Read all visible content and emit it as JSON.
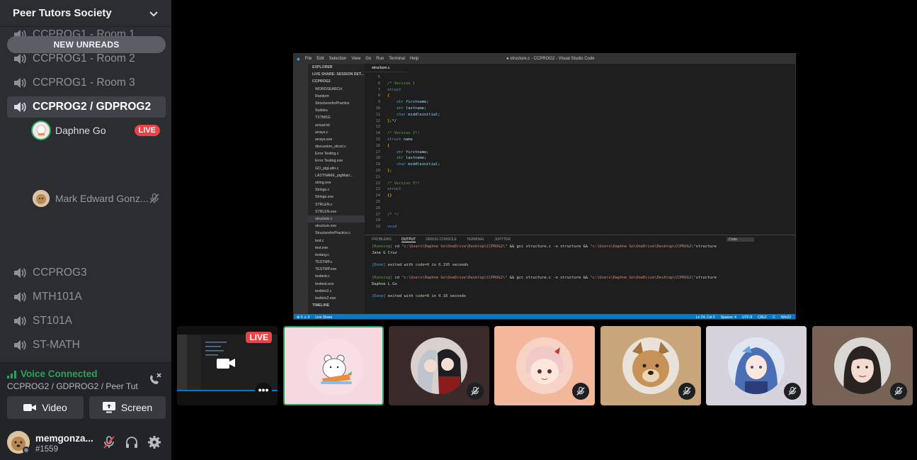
{
  "server": {
    "name": "Peer Tutors Society"
  },
  "new_unreads": "NEW UNREADS",
  "channels": [
    {
      "label": "CCPROG1 - Room 1"
    },
    {
      "label": "CCPROG1 - Room 2"
    },
    {
      "label": "CCPROG1 - Room 3"
    },
    {
      "label": "CCPROG2 / GDPROG2"
    },
    {
      "label": "CCPROG3"
    },
    {
      "label": "MTH101A"
    },
    {
      "label": "ST101A"
    },
    {
      "label": "ST-MATH"
    }
  ],
  "voice_users": [
    {
      "name": "Daphne Go",
      "badge": "LIVE"
    },
    {
      "name": "Mark Edward Gonz..."
    }
  ],
  "voice_panel": {
    "status": "Voice Connected",
    "location": "CCPROG2 / GDPROG2 / Peer Tut...",
    "video_label": "Video",
    "screen_label": "Screen"
  },
  "user": {
    "name": "memgonza...",
    "tag": "#1559"
  },
  "colors": {
    "connected": "#23a55a",
    "live": "#ed4245",
    "sidebar": "#2b2d31",
    "speaking_ring": "#23a55a"
  },
  "vscode": {
    "window_title": "● structure.c - CCPROG2 - Visual Studio Code",
    "menu": [
      "File",
      "Edit",
      "Selection",
      "View",
      "Go",
      "Run",
      "Terminal",
      "Help"
    ],
    "tab": "structure.c",
    "explorer_header": "EXPLORER",
    "explorer_items": [
      "LIVE SHARE: SESSION DET...",
      "CCPROG2",
      "WORDSEARCH",
      "Random",
      "StructuresforPractice",
      "Sudoku",
      "TXTMSG",
      "actual.txt",
      "arrays.c",
      "arrays.exe",
      "discussion_struct.c",
      "Error Testing.c",
      "Error Testing.exe",
      "GO_pigLatin.c",
      "LASTNAME_pigMain...",
      "string.exe",
      "Strings.c",
      "Strings.exe",
      "STRLEN.c",
      "STRLEN.exe",
      "structure.c",
      "structure.exe",
      "StructureforPractice.c",
      "test.c",
      "test.exe",
      "testarg.c",
      "TESTMP.c",
      "TESTMP.exe",
      "testtext.c",
      "testtext.exe",
      "testtxtv2.c",
      "testtxtv2.exe",
      "TIMELINE"
    ],
    "code": [
      {
        "n": "5",
        "t": ""
      },
      {
        "n": "6",
        "t": "/* Version 1"
      },
      {
        "n": "7",
        "t": "struct"
      },
      {
        "n": "8",
        "t": "{"
      },
      {
        "n": "9",
        "t": "    str firstname;"
      },
      {
        "n": "10",
        "t": "    str lastname;"
      },
      {
        "n": "11",
        "t": "    char middleinitial;"
      },
      {
        "n": "12",
        "t": "};*/"
      },
      {
        "n": "13",
        "t": ""
      },
      {
        "n": "14",
        "t": "/* Version 2*/"
      },
      {
        "n": "15",
        "t": "struct name"
      },
      {
        "n": "16",
        "t": "{"
      },
      {
        "n": "17",
        "t": "    str firstname;"
      },
      {
        "n": "18",
        "t": "    str lastname;"
      },
      {
        "n": "19",
        "t": "    char middleinitial;"
      },
      {
        "n": "20",
        "t": "};"
      },
      {
        "n": "21",
        "t": ""
      },
      {
        "n": "22",
        "t": "/* Version 3*/"
      },
      {
        "n": "23",
        "t": "struct"
      },
      {
        "n": "24",
        "t": "{}"
      },
      {
        "n": "25",
        "t": ""
      },
      {
        "n": "26",
        "t": ""
      },
      {
        "n": "27",
        "t": "/* */"
      },
      {
        "n": "28",
        "t": ""
      },
      {
        "n": "29",
        "t": "void"
      }
    ],
    "panel_tabs": [
      "PROBLEMS",
      "OUTPUT",
      "DEBUG CONSOLE",
      "TERMINAL",
      "JUPYTER"
    ],
    "output_select": "Code",
    "output": [
      "[Running] cd \"c:\\Users\\Daphne Go\\OneDrive\\Desktop\\CCPROG2\\\" && gcc structure.c -o structure && \"c:\\Users\\Daphne Go\\OneDrive\\Desktop\\CCPROG2\\\"structure",
      "Jane G Cruz",
      "",
      "[Done] exited with code=0 in 0.195 seconds",
      "",
      "[Running] cd \"c:\\Users\\Daphne Go\\OneDrive\\Desktop\\CCPROG2\\\" && gcc structure.c -o structure && \"c:\\Users\\Daphne Go\\OneDrive\\Desktop\\CCPROG2\\\"structure",
      "Daphne L Go",
      "",
      "[Done] exited with code=0 in 0.18 seconds"
    ],
    "status_left": [
      "⊗ 0 ⚠ 0",
      "Live Share"
    ],
    "status_right": [
      "Ln 24, Col 2",
      "Spaces: 4",
      "UTF-8",
      "CRLF",
      "C",
      "Win32"
    ]
  },
  "tiles": [
    {
      "live": "LIVE",
      "dots": "•••"
    }
  ]
}
